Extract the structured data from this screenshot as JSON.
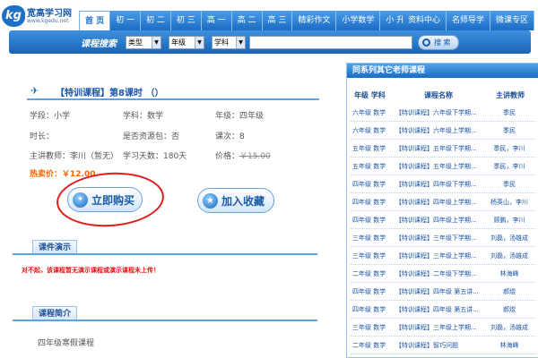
{
  "logo": {
    "mark": "kg",
    "name": "宽高学习网",
    "url": "www.kgedu.net"
  },
  "nav": {
    "items": [
      "首 页",
      "初 一",
      "初 二",
      "初 三",
      "高 一",
      "高 二",
      "高 三",
      "精彩作文",
      "小学数学",
      "小 升 初"
    ],
    "right_items": [
      "资料中心",
      "名师导学",
      "微课专区"
    ]
  },
  "search": {
    "label": "课程搜索",
    "type_select": "类型",
    "grade_select": "年级",
    "subject_select": "学科",
    "input_value": "",
    "button_label": "搜 索"
  },
  "course": {
    "title": "【特训课程】第8课时 （）",
    "stage": "学段：小学",
    "subject": "学科：数学",
    "grade": "年级：四年级",
    "duration": "时长：",
    "hosted": "是否资源包：否",
    "lessons": "课次：8",
    "teacher": "主讲教师：李川（暂无）",
    "study_days": "学习天数：180天",
    "price_label": "价格：",
    "price_original": "￥15.00",
    "hot_price": "热卖价：￥12.00",
    "buy_label": "立即购买",
    "fav_label": "加入收藏"
  },
  "sections": {
    "demo_title": "课件演示",
    "demo_warning": "对不起，该课程暂无演示课程或演示课程未上传！",
    "intro_title": "课程简介",
    "intro_text": "四年级寒假课程"
  },
  "sidebar": {
    "title": "同系列其它老师课程",
    "columns": [
      "年级 学科",
      "课程名称",
      "主讲教师"
    ],
    "rows": [
      [
        "六年级 数学",
        "【特训课程】六年级下学期...",
        "季民"
      ],
      [
        "六年级 数学",
        "【特训课程】六年级上学期...",
        "季民"
      ],
      [
        "五年级 数学",
        "【特训课程】五年级下学期...",
        "季民，李川"
      ],
      [
        "五年级 数学",
        "【特训课程】五年级上学期...",
        "季民，李川"
      ],
      [
        "四年级 数学",
        "【特训课程】四年级下学期...",
        "季民"
      ],
      [
        "四年级 数学",
        "【特训课程】四年级上学期...",
        "杨英山，李川"
      ],
      [
        "四年级 数学",
        "【特训课程】四年级上学期...",
        "顾鹏，李川"
      ],
      [
        "三年级 数学",
        "【特训课程】三年级下学期...",
        "刘磊，汤雄成"
      ],
      [
        "三年级 数学",
        "【特训课程】三年级上学期...",
        "刘磊，汤雄成"
      ],
      [
        "二年级 数学",
        "【特训课程】二年级下学期...",
        "林海峰"
      ],
      [
        "四年级 数学",
        "【特训课程】四年级 第五讲...",
        "郝煜"
      ],
      [
        "四年级 数学",
        "【特训课程】四年级 第五讲...",
        "郝煜"
      ],
      [
        "三年级 数学",
        "【特训课程】三年级上学期...",
        "刘磊，汤雄成"
      ],
      [
        "二年级 数学",
        "【特训课程】智巧问题",
        "林海峰"
      ]
    ]
  },
  "colors": {
    "primary": "#1b6cc4",
    "hot_price": "#ff6600",
    "warning": "#e41010",
    "annotation": "#e11b1b"
  }
}
